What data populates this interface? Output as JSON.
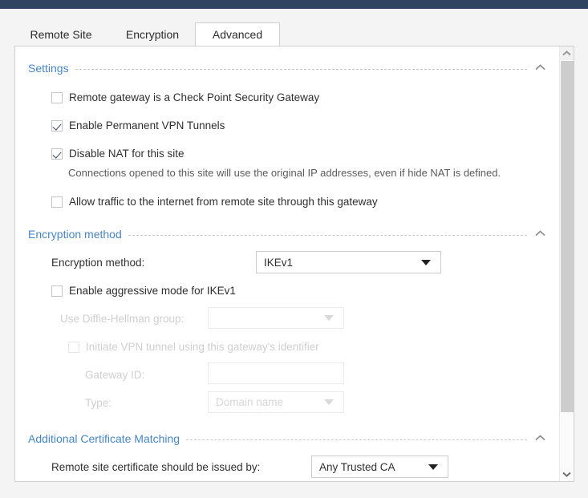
{
  "window": {
    "titlebar_color": "#2e4460"
  },
  "tabs": [
    {
      "label": "Remote Site",
      "active": false
    },
    {
      "label": "Encryption",
      "active": false
    },
    {
      "label": "Advanced",
      "active": true
    }
  ],
  "accent_color": "#4786c6",
  "sections": {
    "settings": {
      "title": "Settings",
      "chevron": "chevron-up-icon",
      "checkboxes": [
        {
          "label": "Remote gateway is a Check Point Security Gateway",
          "checked": false,
          "disabled": false
        },
        {
          "label": "Enable Permanent VPN Tunnels",
          "checked": true,
          "disabled": false
        },
        {
          "label": "Disable NAT for this site",
          "checked": true,
          "disabled": false
        },
        {
          "label": "Allow traffic to the internet from remote site through this gateway",
          "checked": false,
          "disabled": false
        }
      ],
      "hint": "Connections opened to this site will use the original IP addresses, even if hide NAT is defined."
    },
    "encryption_method": {
      "title": "Encryption method",
      "chevron": "chevron-up-icon",
      "method_label": "Encryption method:",
      "method_value": "IKEv1",
      "aggressive_label": "Enable aggressive mode for IKEv1",
      "aggressive_checked": false,
      "dh_label": "Use Diffie-Hellman group:",
      "dh_value": "",
      "initiate_label": "Initiate VPN tunnel using this gateway's identifier",
      "initiate_checked": false,
      "gateway_id_label": "Gateway ID:",
      "gateway_id_value": "",
      "type_label": "Type:",
      "type_value": "Domain name"
    },
    "additional_certificate_matching": {
      "title": "Additional Certificate Matching",
      "chevron": "chevron-up-icon",
      "issuer_label": "Remote site certificate should be issued by:",
      "issuer_value": "Any Trusted CA"
    }
  },
  "scrollbar": {
    "up_icon": "chevron-up-icon",
    "down_icon": "chevron-down-icon"
  }
}
